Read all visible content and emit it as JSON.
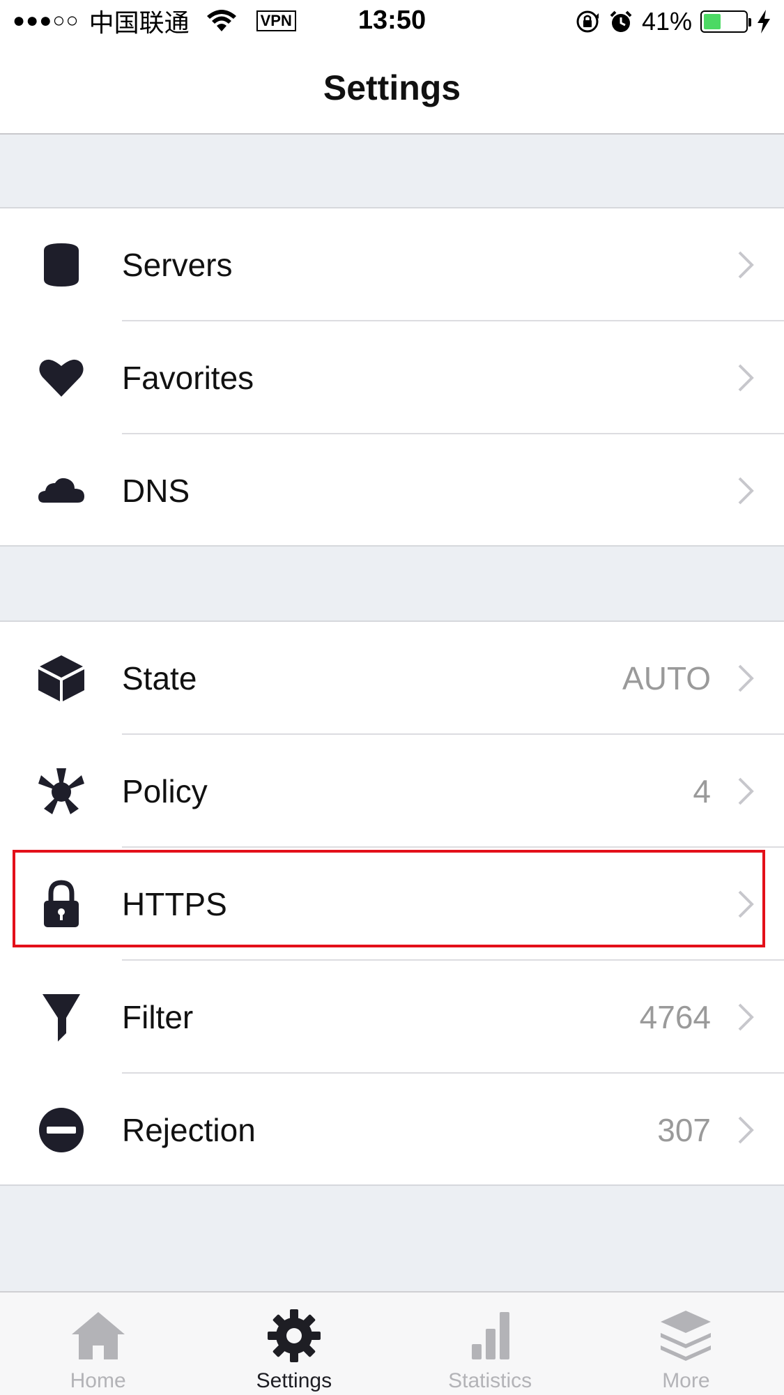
{
  "status_bar": {
    "signal": "●●●○○",
    "carrier": "中国联通",
    "vpn": "VPN",
    "time": "13:50",
    "battery_percent": "41%",
    "battery_level": 0.41,
    "battery_color": "#4cd964"
  },
  "nav": {
    "title": "Settings"
  },
  "groups": [
    {
      "rows": [
        {
          "icon": "database-icon",
          "label": "Servers",
          "value": ""
        },
        {
          "icon": "heart-icon",
          "label": "Favorites",
          "value": ""
        },
        {
          "icon": "cloud-icon",
          "label": "DNS",
          "value": ""
        }
      ]
    },
    {
      "rows": [
        {
          "icon": "cube-icon",
          "label": "State",
          "value": "AUTO"
        },
        {
          "icon": "policy-icon",
          "label": "Policy",
          "value": "4"
        },
        {
          "icon": "lock-icon",
          "label": "HTTPS",
          "value": "",
          "highlighted": true
        },
        {
          "icon": "funnel-icon",
          "label": "Filter",
          "value": "4764"
        },
        {
          "icon": "minus-circle-icon",
          "label": "Rejection",
          "value": "307"
        }
      ]
    }
  ],
  "highlight_color": "#e3101a",
  "tab_bar": {
    "tabs": [
      {
        "icon": "home-icon",
        "label": "Home",
        "active": false
      },
      {
        "icon": "gear-icon",
        "label": "Settings",
        "active": true
      },
      {
        "icon": "bar-chart-icon",
        "label": "Statistics",
        "active": false
      },
      {
        "icon": "layers-icon",
        "label": "More",
        "active": false
      }
    ]
  }
}
